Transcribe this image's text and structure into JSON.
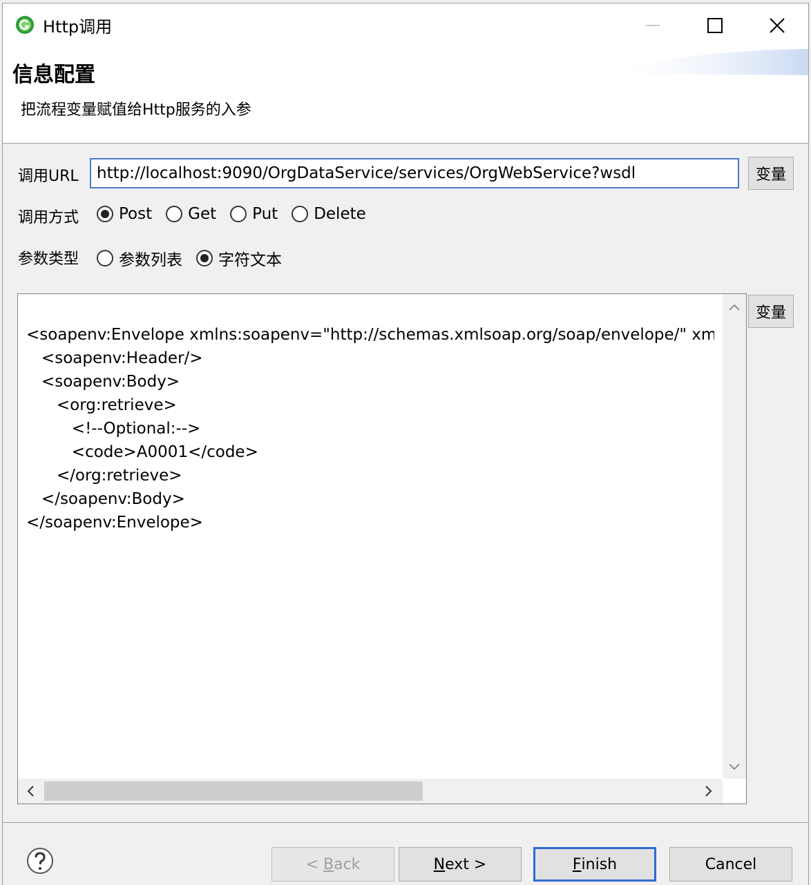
{
  "window": {
    "title": "Http调用"
  },
  "banner": {
    "title": "信息配置",
    "description": "把流程变量赋值给Http服务的入参"
  },
  "url": {
    "label": "调用URL",
    "value": "http://localhost:9090/OrgDataService/services/OrgWebService?wsdl",
    "var_button": "变量"
  },
  "method": {
    "label": "调用方式",
    "options": [
      {
        "label": "Post",
        "selected": true
      },
      {
        "label": "Get",
        "selected": false
      },
      {
        "label": "Put",
        "selected": false
      },
      {
        "label": "Delete",
        "selected": false
      }
    ]
  },
  "param_type": {
    "label": "参数类型",
    "options": [
      {
        "label": "参数列表",
        "selected": false
      },
      {
        "label": "字符文本",
        "selected": true
      }
    ]
  },
  "editor": {
    "var_button": "变量",
    "lines": [
      "<soapenv:Envelope xmlns:soapenv=\"http://schemas.xmlsoap.org/soap/envelope/\" xmlns:org=\"http://",
      "   <soapenv:Header/>",
      "   <soapenv:Body>",
      "      <org:retrieve>",
      "         <!--Optional:-->",
      "         <code>A0001</code>",
      "      </org:retrieve>",
      "   </soapenv:Body>",
      "</soapenv:Envelope>"
    ]
  },
  "footer": {
    "back": {
      "prefix": "< ",
      "mnemonic": "B",
      "rest": "ack"
    },
    "next": {
      "mnemonic": "N",
      "rest": "ext >"
    },
    "finish": {
      "mnemonic": "F",
      "rest": "inish"
    },
    "cancel": "Cancel"
  },
  "colors": {
    "accent": "#2f6ad0",
    "input_border": "#4a78c8"
  }
}
